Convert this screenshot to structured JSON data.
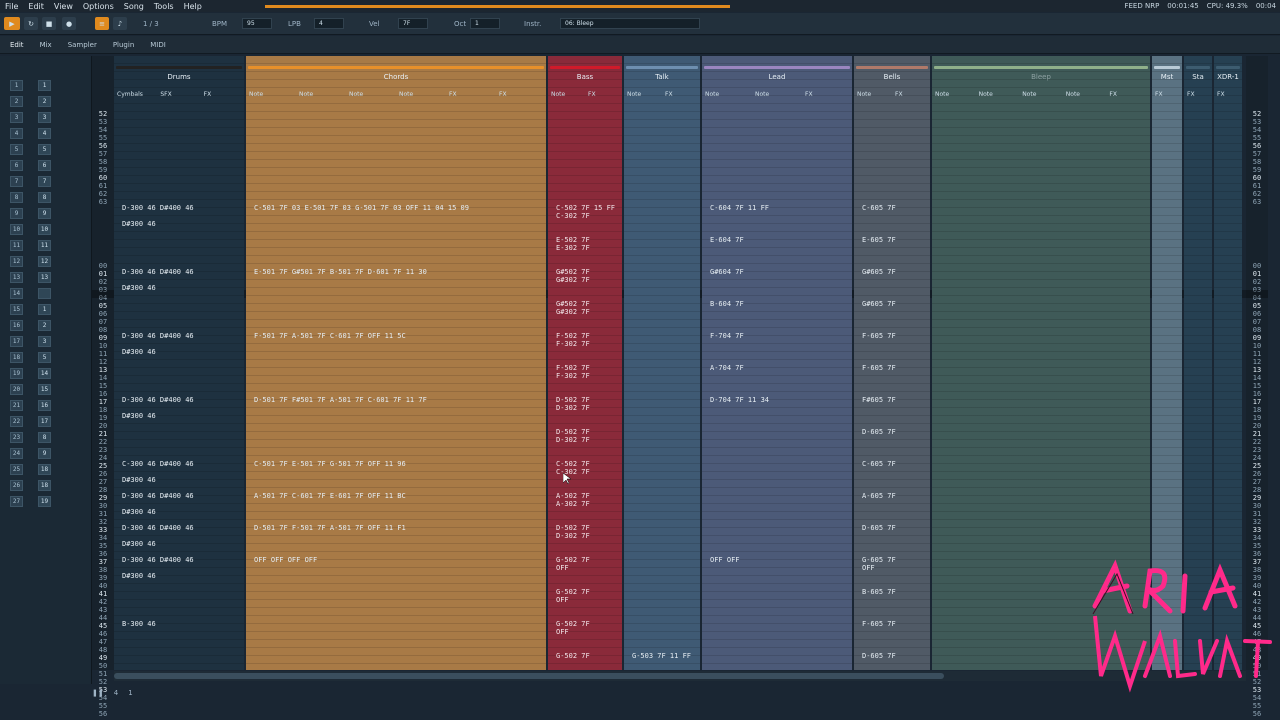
{
  "menu": [
    "File",
    "Edit",
    "View",
    "Options",
    "Song",
    "Tools",
    "Help"
  ],
  "status": {
    "fps": "FEED NRP",
    "time": "00:01:45",
    "cpu": "CPU: 49.3%",
    "clock": "00:04"
  },
  "toolbar": {
    "pattern_counter": "1 / 3",
    "bpm_label": "BPM",
    "bpm_value": "95",
    "lpb_label": "LPB",
    "lpb_value": "4",
    "vel_label": "Vel",
    "vel_value": "7F",
    "oct_label": "Oct",
    "oct_value": "1",
    "instr_label": "Instr.",
    "instr_value": "06: Bleep"
  },
  "tabs": [
    "Edit",
    "Mix",
    "Sampler",
    "Plugin",
    "MIDI"
  ],
  "sequencer": {
    "rows": [
      {
        "pos": "1",
        "pat": "1"
      },
      {
        "pos": "2",
        "pat": "2"
      },
      {
        "pos": "3",
        "pat": "3"
      },
      {
        "pos": "4",
        "pat": "4"
      },
      {
        "pos": "5",
        "pat": "5"
      },
      {
        "pos": "6",
        "pat": "6"
      },
      {
        "pos": "7",
        "pat": "7"
      },
      {
        "pos": "8",
        "pat": "8"
      },
      {
        "pos": "9",
        "pat": "9"
      },
      {
        "pos": "10",
        "pat": "10"
      },
      {
        "pos": "11",
        "pat": "11"
      },
      {
        "pos": "12",
        "pat": "12"
      },
      {
        "pos": "13",
        "pat": "13"
      },
      {
        "pos": "14",
        "pat": ""
      },
      {
        "pos": "15",
        "pat": "1"
      },
      {
        "pos": "16",
        "pat": "2"
      },
      {
        "pos": "17",
        "pat": "3"
      },
      {
        "pos": "18",
        "pat": "5"
      },
      {
        "pos": "19",
        "pat": "14"
      },
      {
        "pos": "20",
        "pat": "15"
      },
      {
        "pos": "21",
        "pat": "16"
      },
      {
        "pos": "22",
        "pat": "17"
      },
      {
        "pos": "23",
        "pat": "8"
      },
      {
        "pos": "24",
        "pat": "9"
      },
      {
        "pos": "25",
        "pat": "18"
      },
      {
        "pos": "26",
        "pat": "18"
      },
      {
        "pos": "27",
        "pat": "19"
      }
    ]
  },
  "row_numbers": [
    "52",
    "53",
    "54",
    "55",
    "56",
    "57",
    "58",
    "59",
    "60",
    "61",
    "62",
    "63",
    "",
    "",
    "",
    "",
    "",
    "",
    "",
    "00",
    "01",
    "02",
    "03",
    "04",
    "05",
    "06",
    "07",
    "08",
    "09",
    "10",
    "11",
    "12",
    "13",
    "14",
    "15",
    "16",
    "17",
    "18",
    "19",
    "20",
    "21",
    "22",
    "23",
    "24",
    "25",
    "26",
    "27",
    "28",
    "29",
    "30",
    "31",
    "32",
    "33",
    "34",
    "35",
    "36",
    "37",
    "38",
    "39",
    "40",
    "41",
    "42",
    "43",
    "44",
    "45",
    "46",
    "47",
    "48",
    "49",
    "50",
    "51",
    "52",
    "53",
    "54",
    "55",
    "56"
  ],
  "tracks": [
    {
      "name": "Drums",
      "color": "#222222",
      "cols": [
        "Cymbals",
        "SFX",
        "FX"
      ]
    },
    {
      "name": "Chords",
      "color": "#e8902a",
      "cols": [
        "Note",
        "Note",
        "Note",
        "Note",
        "FX",
        "FX"
      ]
    },
    {
      "name": "Bass",
      "color": "#d01a2a",
      "cols": [
        "Note",
        "FX"
      ]
    },
    {
      "name": "Talk",
      "color": "#6e8fb0",
      "cols": [
        "Note",
        "FX"
      ]
    },
    {
      "name": "Lead",
      "color": "#9a86c0",
      "cols": [
        "Note",
        "Note",
        "FX"
      ]
    },
    {
      "name": "Bells",
      "color": "#b07a6a",
      "cols": [
        "Note",
        "FX"
      ]
    },
    {
      "name": "Bleep",
      "color": "#8fb08a",
      "cols": [
        "Note",
        "Note",
        "Note",
        "Note",
        "FX"
      ]
    },
    {
      "name": "Mst",
      "color": "#b8cad6",
      "cols": [
        "FX"
      ]
    },
    {
      "name": "Sta",
      "color": "#3d5c70",
      "cols": [
        "FX"
      ]
    },
    {
      "name": "XDR-1",
      "color": "#3d5c70",
      "cols": [
        "FX"
      ]
    }
  ],
  "notes": {
    "drums": [
      {
        "row": 19,
        "t": "D-300 46 D#400 46"
      },
      {
        "row": 21,
        "t": "D#300 46"
      },
      {
        "row": 27,
        "t": "D-300 46 D#400 46"
      },
      {
        "row": 29,
        "t": "D#300 46"
      },
      {
        "row": 35,
        "t": "D-300 46 D#400 46"
      },
      {
        "row": 37,
        "t": "D#300 46"
      },
      {
        "row": 43,
        "t": "D-300 46 D#400 46"
      },
      {
        "row": 45,
        "t": "D#300 46"
      },
      {
        "row": 51,
        "t": "C-300 46 D#400 46"
      },
      {
        "row": 53,
        "t": "D#300 46"
      },
      {
        "row": 55,
        "t": "D-300 46 D#400 46"
      },
      {
        "row": 57,
        "t": "D#300 46"
      },
      {
        "row": 59,
        "t": "D-300 46 D#400 46"
      },
      {
        "row": 61,
        "t": "D#300 46"
      },
      {
        "row": 63,
        "t": "D-300 46 D#400 46"
      },
      {
        "row": 65,
        "t": "D#300 46"
      },
      {
        "row": 71,
        "t": "B-300 46"
      }
    ],
    "chords": [
      {
        "row": 19,
        "t": "C-501 7F 03  E-501 7F 03  G-501 7F 03  OFF         11 04  15 09"
      },
      {
        "row": 27,
        "t": "E-501 7F      G#501 7F      B-501 7F      D-601 7F    11 30"
      },
      {
        "row": 35,
        "t": "F-501 7F      A-501 7F      C-601 7F      OFF         11 5C"
      },
      {
        "row": 43,
        "t": "D-501 7F      F#501 7F      A-501 7F      C-601 7F    11 7F"
      },
      {
        "row": 51,
        "t": "C-501 7F      E-501 7F      G-501 7F      OFF         11 96"
      },
      {
        "row": 55,
        "t": "A-501 7F      C-601 7F      E-601 7F      OFF         11 BC"
      },
      {
        "row": 59,
        "t": "D-501 7F      F-501 7F      A-501 7F      OFF         11 F1"
      },
      {
        "row": 63,
        "t": "OFF           OFF           OFF           OFF"
      }
    ],
    "bass": [
      {
        "row": 19,
        "t": "C-502 7F 15 FF"
      },
      {
        "row": 20,
        "t": "C-302 7F"
      },
      {
        "row": 23,
        "t": "E-502 7F"
      },
      {
        "row": 24,
        "t": "E-302 7F"
      },
      {
        "row": 27,
        "t": "G#502 7F"
      },
      {
        "row": 28,
        "t": "G#302 7F"
      },
      {
        "row": 31,
        "t": "G#502 7F"
      },
      {
        "row": 32,
        "t": "G#302 7F"
      },
      {
        "row": 35,
        "t": "F-502 7F"
      },
      {
        "row": 36,
        "t": "F-302 7F"
      },
      {
        "row": 39,
        "t": "F-502 7F"
      },
      {
        "row": 40,
        "t": "F-302 7F"
      },
      {
        "row": 43,
        "t": "D-502 7F"
      },
      {
        "row": 44,
        "t": "D-302 7F"
      },
      {
        "row": 47,
        "t": "D-502 7F"
      },
      {
        "row": 48,
        "t": "D-302 7F"
      },
      {
        "row": 51,
        "t": "C-502 7F"
      },
      {
        "row": 52,
        "t": "C-302 7F"
      },
      {
        "row": 55,
        "t": "A-502 7F"
      },
      {
        "row": 56,
        "t": "A-302 7F"
      },
      {
        "row": 59,
        "t": "D-502 7F"
      },
      {
        "row": 60,
        "t": "D-302 7F"
      },
      {
        "row": 63,
        "t": "G-502 7F"
      },
      {
        "row": 64,
        "t": "OFF"
      },
      {
        "row": 67,
        "t": "G-502 7F"
      },
      {
        "row": 68,
        "t": "OFF"
      },
      {
        "row": 71,
        "t": "G-502 7F"
      },
      {
        "row": 72,
        "t": "OFF"
      },
      {
        "row": 75,
        "t": "G-502 7F"
      }
    ],
    "talk": [
      {
        "row": 75,
        "t": "G-503 7F  11 FF"
      }
    ],
    "lead": [
      {
        "row": 19,
        "t": "C-604 7F          11 FF"
      },
      {
        "row": 23,
        "t": "          E-604 7F"
      },
      {
        "row": 27,
        "t": "G#604 7F"
      },
      {
        "row": 31,
        "t": "          B-604 7F"
      },
      {
        "row": 35,
        "t": "F-704 7F"
      },
      {
        "row": 39,
        "t": "          A-704 7F"
      },
      {
        "row": 43,
        "t": "D-704 7F          11 34"
      },
      {
        "row": 63,
        "t": "OFF       OFF"
      }
    ],
    "bells": [
      {
        "row": 19,
        "t": "C-605 7F"
      },
      {
        "row": 23,
        "t": "E-605 7F"
      },
      {
        "row": 27,
        "t": "G#605 7F"
      },
      {
        "row": 31,
        "t": "G#605 7F"
      },
      {
        "row": 35,
        "t": "F-605 7F"
      },
      {
        "row": 39,
        "t": "F-605 7F"
      },
      {
        "row": 43,
        "t": "F#605 7F"
      },
      {
        "row": 47,
        "t": "D-605 7F"
      },
      {
        "row": 51,
        "t": "C-605 7F"
      },
      {
        "row": 55,
        "t": "A-605 7F"
      },
      {
        "row": 59,
        "t": "D-605 7F"
      },
      {
        "row": 63,
        "t": "G-605 7F"
      },
      {
        "row": 64,
        "t": "OFF"
      },
      {
        "row": 67,
        "t": "B-605 7F"
      },
      {
        "row": 71,
        "t": "F-605 7F"
      },
      {
        "row": 75,
        "t": "D-605 7F"
      }
    ]
  },
  "bottom": {
    "oct": "4",
    "step": "1"
  }
}
